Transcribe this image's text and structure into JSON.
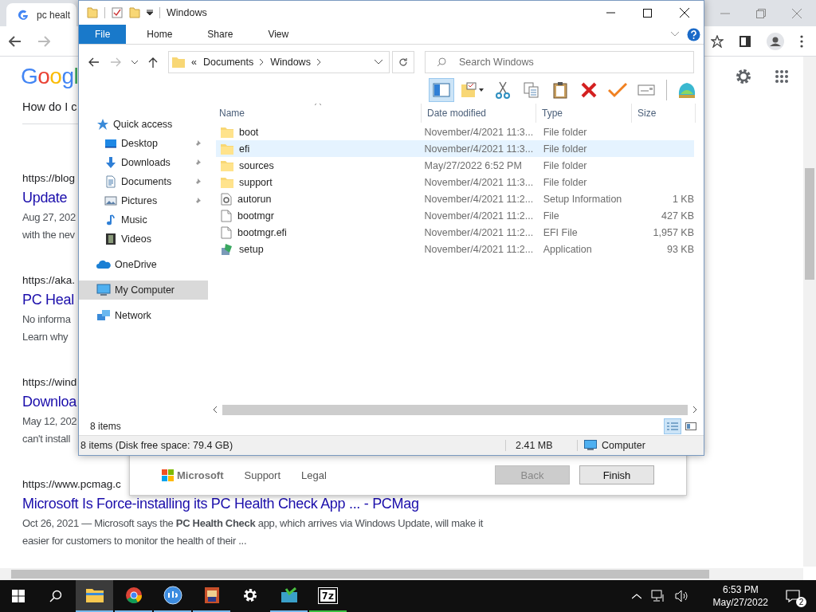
{
  "browser": {
    "tab_title": "pc healt",
    "logo": "Googl",
    "question": "How do I c",
    "results": [
      {
        "url": "https://blog",
        "title": "Update",
        "snippet": [
          "Aug 27, 202",
          "with the nev"
        ]
      },
      {
        "url": "https://aka.",
        "title": "PC Heal",
        "snippet": [
          "No informa",
          "Learn why"
        ]
      },
      {
        "url": "https://wind",
        "title": "Downloa",
        "snippet": [
          "May 12, 202",
          "can't install"
        ]
      },
      {
        "url": "https://www.pcmag.c",
        "title": "Microsoft Is Force-installing its PC Health Check App ... - PCMag",
        "snippet": [
          "Oct 26, 2021 — Microsoft says the **PC Health Check** app, which arrives via Windows Update, will make it easier for customers to monitor the health of their ..."
        ]
      }
    ]
  },
  "dialog": {
    "brand": "Microsoft",
    "links": [
      "Support",
      "Legal"
    ],
    "buttons": [
      {
        "label": "Back",
        "disabled": true
      },
      {
        "label": "Finish",
        "disabled": false
      }
    ]
  },
  "explorer": {
    "title": "Windows",
    "ribbon_tabs": [
      {
        "label": "File",
        "selected": true
      },
      {
        "label": "Home",
        "selected": false
      },
      {
        "label": "Share",
        "selected": false
      },
      {
        "label": "View",
        "selected": false
      }
    ],
    "address": {
      "overflow": "«",
      "parts": [
        "Documents",
        "Windows"
      ]
    },
    "search": {
      "placeholder": "Search Windows"
    },
    "toolbar": [
      {
        "kind": "pane",
        "selected": true
      },
      {
        "kind": "properties",
        "selected": false
      },
      {
        "kind": "cut",
        "selected": false
      },
      {
        "kind": "copy",
        "selected": false
      },
      {
        "kind": "paste",
        "selected": false
      },
      {
        "kind": "delete",
        "selected": false
      },
      {
        "kind": "check",
        "selected": false
      },
      {
        "kind": "rename",
        "selected": false
      },
      {
        "kind": "shell",
        "selected": false
      }
    ],
    "columns": [
      "Name",
      "Date modified",
      "Type",
      "Size"
    ],
    "nav": [
      {
        "label": "Quick access",
        "kind": "star",
        "selected": false,
        "children": [
          {
            "label": "Desktop",
            "kind": "desktop",
            "pinned": true,
            "selected": false
          },
          {
            "label": "Downloads",
            "kind": "download",
            "pinned": true,
            "selected": false
          },
          {
            "label": "Documents",
            "kind": "document",
            "pinned": true,
            "selected": false
          },
          {
            "label": "Pictures",
            "kind": "pictures",
            "pinned": true,
            "selected": false
          },
          {
            "label": "Music",
            "kind": "music",
            "pinned": false,
            "selected": false
          },
          {
            "label": "Videos",
            "kind": "videos",
            "pinned": false,
            "selected": false
          }
        ]
      },
      {
        "label": "OneDrive",
        "kind": "cloud",
        "selected": false
      },
      {
        "label": "My Computer",
        "kind": "computer",
        "selected": true
      },
      {
        "label": "Network",
        "kind": "network",
        "selected": false
      }
    ],
    "files": [
      {
        "name": "boot",
        "kind": "folder",
        "date": "November/4/2021 11:3...",
        "type": "File folder",
        "selected": false
      },
      {
        "name": "efi",
        "kind": "folder",
        "date": "November/4/2021 11:3...",
        "type": "File folder",
        "selected": true
      },
      {
        "name": "sources",
        "kind": "folder",
        "date": "May/27/2022 6:52 PM",
        "type": "File folder",
        "selected": false
      },
      {
        "name": "support",
        "kind": "folder",
        "date": "November/4/2021 11:3...",
        "type": "File folder",
        "selected": false
      },
      {
        "name": "autorun",
        "kind": "settings",
        "date": "November/4/2021 11:2...",
        "type": "Setup Information",
        "size": "1 KB",
        "selected": false
      },
      {
        "name": "bootmgr",
        "kind": "file",
        "date": "November/4/2021 11:2...",
        "type": "File",
        "size": "427 KB",
        "selected": false
      },
      {
        "name": "bootmgr.efi",
        "kind": "file",
        "date": "November/4/2021 11:2...",
        "type": "EFI File",
        "size": "1,957 KB",
        "selected": false
      },
      {
        "name": "setup",
        "kind": "setup",
        "date": "November/4/2021 11:2...",
        "type": "Application",
        "size": "93 KB",
        "selected": false
      }
    ],
    "item_count": "8 items",
    "views": [
      {
        "kind": "details",
        "selected": true
      },
      {
        "kind": "tiles",
        "selected": false
      }
    ],
    "status": {
      "text": "8 items (Disk free space: 79.4 GB)",
      "size": "2.41 MB",
      "location": "Computer"
    }
  },
  "taskbar": {
    "apps": [
      {
        "kind": "explorer",
        "selected": true,
        "running": true
      },
      {
        "kind": "chrome",
        "selected": false,
        "running": true
      },
      {
        "kind": "qb",
        "selected": false,
        "running": true
      },
      {
        "kind": "game",
        "selected": false,
        "running": true
      },
      {
        "kind": "gear",
        "selected": false,
        "running": false
      },
      {
        "kind": "sync",
        "selected": false,
        "running": true
      },
      {
        "kind": "sevenzip",
        "label": "7z",
        "selected": false,
        "running": true
      }
    ],
    "time": "6:53 PM",
    "date": "May/27/2022",
    "notifications": "2"
  }
}
